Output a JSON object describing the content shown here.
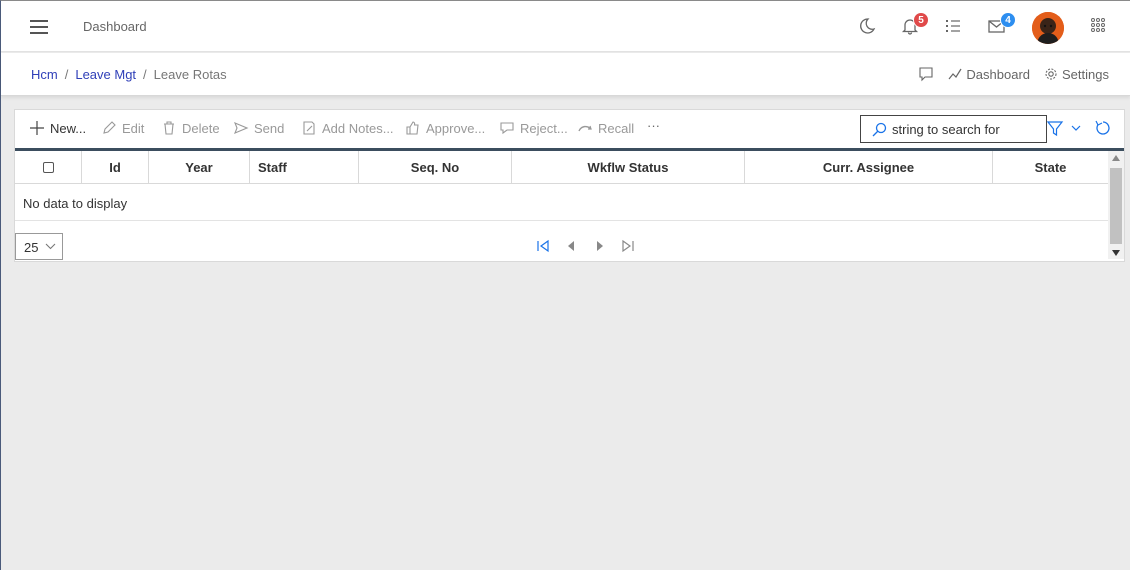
{
  "header": {
    "title": "Dashboard",
    "notifications_count": "5",
    "messages_count": "4"
  },
  "breadcrumb": {
    "items": [
      "Hcm",
      "Leave Mgt"
    ],
    "current": "Leave Rotas"
  },
  "page_actions": {
    "dashboard_label": "Dashboard",
    "settings_label": "Settings"
  },
  "toolbar": {
    "new_label": "New...",
    "edit_label": "Edit",
    "delete_label": "Delete",
    "send_label": "Send",
    "add_notes_label": "Add Notes...",
    "approve_label": "Approve...",
    "reject_label": "Reject...",
    "recall_label": "Recall",
    "more_label": "···"
  },
  "search": {
    "placeholder": "string to search for"
  },
  "grid": {
    "columns": [
      "Id",
      "Year",
      "Staff",
      "Seq. No",
      "Wkflw Status",
      "Curr. Assignee",
      "State"
    ],
    "empty_text": "No data to display"
  },
  "pager": {
    "page_size": "25"
  },
  "colors": {
    "link": "#2f3fb8",
    "grid_header_border": "#3b4d5e",
    "badge_red": "#e04a4a",
    "badge_blue": "#2d8ef0",
    "accent": "#1a73e8"
  }
}
